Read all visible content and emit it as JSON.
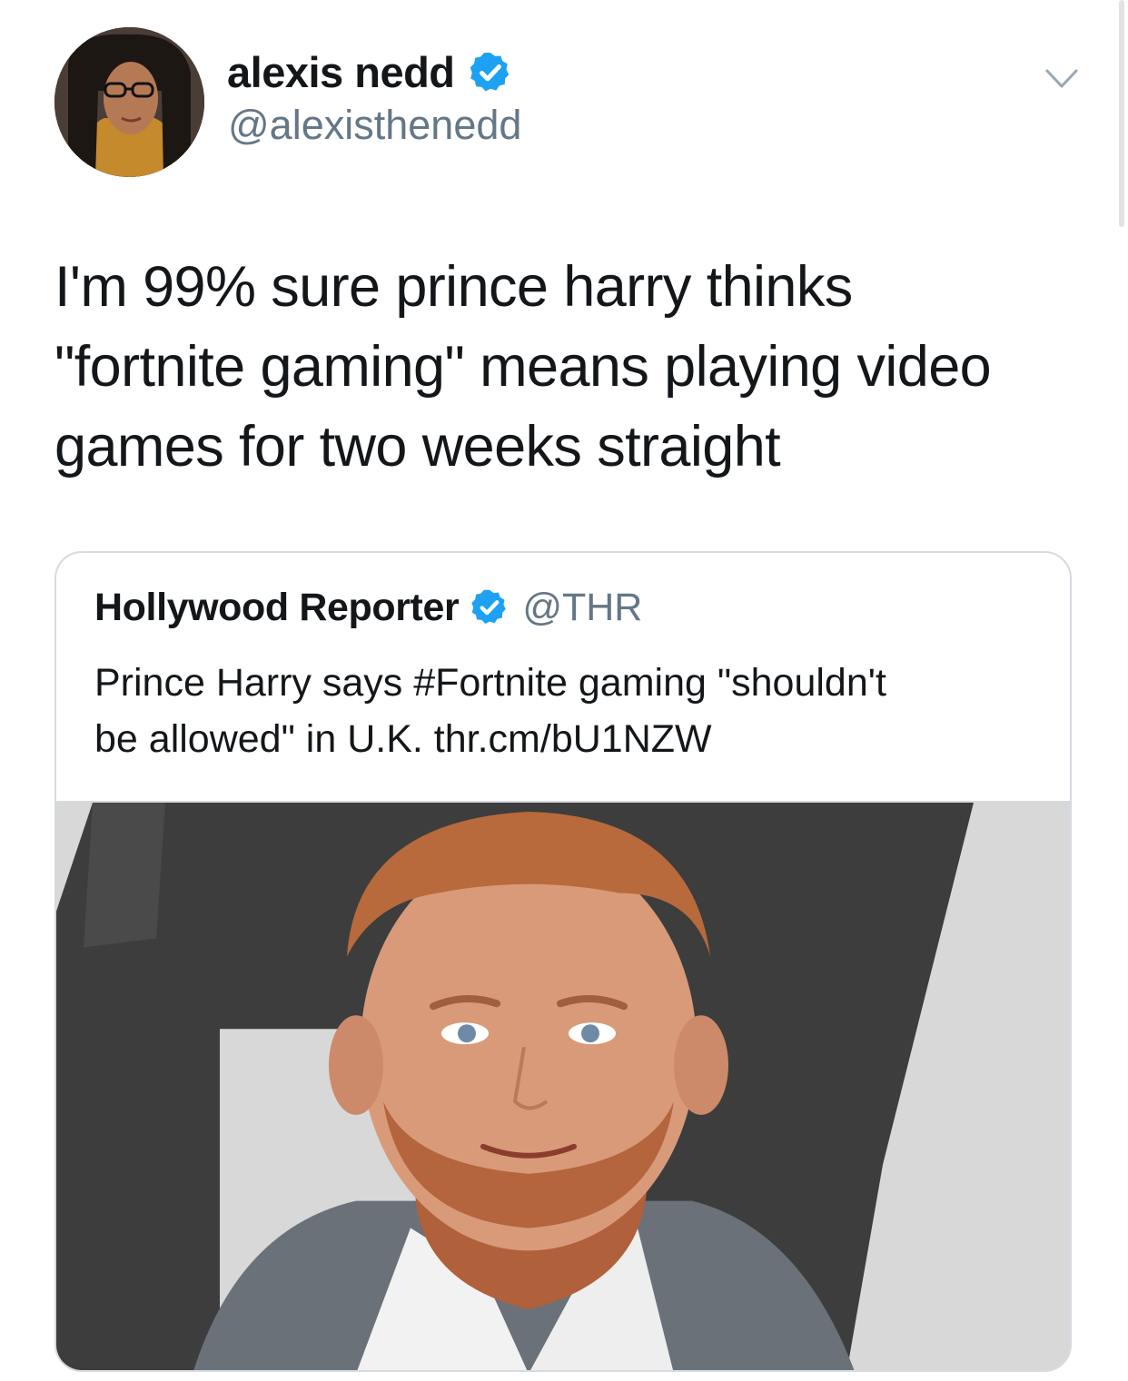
{
  "tweet": {
    "author": {
      "display_name": "alexis nedd",
      "handle": "@alexisthenedd",
      "verified": true,
      "avatar_icon": "profile-photo"
    },
    "text_lines": [
      "I'm 99% sure prince harry thinks",
      "\"fortnite gaming\" means playing video",
      "games for two weeks straight"
    ],
    "menu_icon": "chevron-down-icon"
  },
  "quoted_tweet": {
    "author": {
      "display_name": "Hollywood Reporter",
      "handle": "@THR",
      "verified": true
    },
    "text_lines": [
      "Prince Harry says #Fortnite gaming \"shouldn't",
      "be allowed\" in U.K. thr.cm/bU1NZW"
    ],
    "media": "photo-of-prince-harry"
  },
  "colors": {
    "text": "#14171a",
    "secondary_text": "#657786",
    "verified_badge": "#1da1f2",
    "border": "#d5dbe0"
  }
}
